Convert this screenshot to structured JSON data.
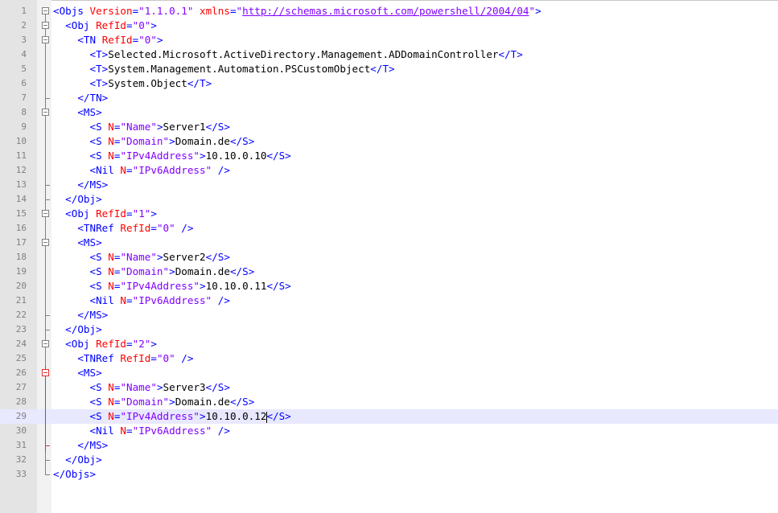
{
  "editor": {
    "caret": {
      "line": 29,
      "after_text": "10.10.0.12"
    },
    "colors": {
      "tag": "#0000ff",
      "attribute": "#ff0000",
      "value": "#8000ff",
      "text": "#000000",
      "line_numbers": "#808080",
      "current_line": "#e8e8ff",
      "gutter": "#e4e4e4"
    },
    "lines": [
      {
        "num": "1",
        "fold": "box-start",
        "indent": "",
        "tokens": [
          {
            "k": "tag",
            "t": "<Objs "
          },
          {
            "k": "attr",
            "t": "Version"
          },
          {
            "k": "tag",
            "t": "="
          },
          {
            "k": "val",
            "t": "\"1.1.0.1\""
          },
          {
            "k": "tag",
            "t": " "
          },
          {
            "k": "attr",
            "t": "xmlns"
          },
          {
            "k": "tag",
            "t": "="
          },
          {
            "k": "val",
            "t": "\""
          },
          {
            "k": "url",
            "t": "http://schemas.microsoft.com/powershell/2004/04"
          },
          {
            "k": "val",
            "t": "\""
          },
          {
            "k": "tag",
            "t": ">"
          }
        ]
      },
      {
        "num": "2",
        "fold": "box",
        "indent": "  ",
        "tokens": [
          {
            "k": "tag",
            "t": "<Obj "
          },
          {
            "k": "attr",
            "t": "RefId"
          },
          {
            "k": "tag",
            "t": "="
          },
          {
            "k": "val",
            "t": "\"0\""
          },
          {
            "k": "tag",
            "t": ">"
          }
        ]
      },
      {
        "num": "3",
        "fold": "box",
        "indent": "    ",
        "tokens": [
          {
            "k": "tag",
            "t": "<TN "
          },
          {
            "k": "attr",
            "t": "RefId"
          },
          {
            "k": "tag",
            "t": "="
          },
          {
            "k": "val",
            "t": "\"0\""
          },
          {
            "k": "tag",
            "t": ">"
          }
        ]
      },
      {
        "num": "4",
        "fold": "line",
        "indent": "      ",
        "tokens": [
          {
            "k": "tag",
            "t": "<T>"
          },
          {
            "k": "txt",
            "t": "Selected.Microsoft.ActiveDirectory.Management.ADDomainController"
          },
          {
            "k": "tag",
            "t": "</T>"
          }
        ]
      },
      {
        "num": "5",
        "fold": "line",
        "indent": "      ",
        "tokens": [
          {
            "k": "tag",
            "t": "<T>"
          },
          {
            "k": "txt",
            "t": "System.Management.Automation.PSCustomObject"
          },
          {
            "k": "tag",
            "t": "</T>"
          }
        ]
      },
      {
        "num": "6",
        "fold": "line",
        "indent": "      ",
        "tokens": [
          {
            "k": "tag",
            "t": "<T>"
          },
          {
            "k": "txt",
            "t": "System.Object"
          },
          {
            "k": "tag",
            "t": "</T>"
          }
        ]
      },
      {
        "num": "7",
        "fold": "end",
        "indent": "    ",
        "tokens": [
          {
            "k": "tag",
            "t": "</TN>"
          }
        ]
      },
      {
        "num": "8",
        "fold": "box",
        "indent": "    ",
        "tokens": [
          {
            "k": "tag",
            "t": "<MS>"
          }
        ]
      },
      {
        "num": "9",
        "fold": "line",
        "indent": "      ",
        "tokens": [
          {
            "k": "tag",
            "t": "<S "
          },
          {
            "k": "attr",
            "t": "N"
          },
          {
            "k": "tag",
            "t": "="
          },
          {
            "k": "val",
            "t": "\"Name\""
          },
          {
            "k": "tag",
            "t": ">"
          },
          {
            "k": "txt",
            "t": "Server1"
          },
          {
            "k": "tag",
            "t": "</S>"
          }
        ]
      },
      {
        "num": "10",
        "fold": "line",
        "indent": "      ",
        "tokens": [
          {
            "k": "tag",
            "t": "<S "
          },
          {
            "k": "attr",
            "t": "N"
          },
          {
            "k": "tag",
            "t": "="
          },
          {
            "k": "val",
            "t": "\"Domain\""
          },
          {
            "k": "tag",
            "t": ">"
          },
          {
            "k": "txt",
            "t": "Domain.de"
          },
          {
            "k": "tag",
            "t": "</S>"
          }
        ]
      },
      {
        "num": "11",
        "fold": "line",
        "indent": "      ",
        "tokens": [
          {
            "k": "tag",
            "t": "<S "
          },
          {
            "k": "attr",
            "t": "N"
          },
          {
            "k": "tag",
            "t": "="
          },
          {
            "k": "val",
            "t": "\"IPv4Address\""
          },
          {
            "k": "tag",
            "t": ">"
          },
          {
            "k": "txt",
            "t": "10.10.0.10"
          },
          {
            "k": "tag",
            "t": "</S>"
          }
        ]
      },
      {
        "num": "12",
        "fold": "line",
        "indent": "      ",
        "tokens": [
          {
            "k": "tag",
            "t": "<Nil "
          },
          {
            "k": "attr",
            "t": "N"
          },
          {
            "k": "tag",
            "t": "="
          },
          {
            "k": "val",
            "t": "\"IPv6Address\""
          },
          {
            "k": "tag",
            "t": " />"
          }
        ]
      },
      {
        "num": "13",
        "fold": "end",
        "indent": "    ",
        "tokens": [
          {
            "k": "tag",
            "t": "</MS>"
          }
        ]
      },
      {
        "num": "14",
        "fold": "end",
        "indent": "  ",
        "tokens": [
          {
            "k": "tag",
            "t": "</Obj>"
          }
        ]
      },
      {
        "num": "15",
        "fold": "box",
        "indent": "  ",
        "tokens": [
          {
            "k": "tag",
            "t": "<Obj "
          },
          {
            "k": "attr",
            "t": "RefId"
          },
          {
            "k": "tag",
            "t": "="
          },
          {
            "k": "val",
            "t": "\"1\""
          },
          {
            "k": "tag",
            "t": ">"
          }
        ]
      },
      {
        "num": "16",
        "fold": "line",
        "indent": "    ",
        "tokens": [
          {
            "k": "tag",
            "t": "<TNRef "
          },
          {
            "k": "attr",
            "t": "RefId"
          },
          {
            "k": "tag",
            "t": "="
          },
          {
            "k": "val",
            "t": "\"0\""
          },
          {
            "k": "tag",
            "t": " />"
          }
        ]
      },
      {
        "num": "17",
        "fold": "box",
        "indent": "    ",
        "tokens": [
          {
            "k": "tag",
            "t": "<MS>"
          }
        ]
      },
      {
        "num": "18",
        "fold": "line",
        "indent": "      ",
        "tokens": [
          {
            "k": "tag",
            "t": "<S "
          },
          {
            "k": "attr",
            "t": "N"
          },
          {
            "k": "tag",
            "t": "="
          },
          {
            "k": "val",
            "t": "\"Name\""
          },
          {
            "k": "tag",
            "t": ">"
          },
          {
            "k": "txt",
            "t": "Server2"
          },
          {
            "k": "tag",
            "t": "</S>"
          }
        ]
      },
      {
        "num": "19",
        "fold": "line",
        "indent": "      ",
        "tokens": [
          {
            "k": "tag",
            "t": "<S "
          },
          {
            "k": "attr",
            "t": "N"
          },
          {
            "k": "tag",
            "t": "="
          },
          {
            "k": "val",
            "t": "\"Domain\""
          },
          {
            "k": "tag",
            "t": ">"
          },
          {
            "k": "txt",
            "t": "Domain.de"
          },
          {
            "k": "tag",
            "t": "</S>"
          }
        ]
      },
      {
        "num": "20",
        "fold": "line",
        "indent": "      ",
        "tokens": [
          {
            "k": "tag",
            "t": "<S "
          },
          {
            "k": "attr",
            "t": "N"
          },
          {
            "k": "tag",
            "t": "="
          },
          {
            "k": "val",
            "t": "\"IPv4Address\""
          },
          {
            "k": "tag",
            "t": ">"
          },
          {
            "k": "txt",
            "t": "10.10.0.11"
          },
          {
            "k": "tag",
            "t": "</S>"
          }
        ]
      },
      {
        "num": "21",
        "fold": "line",
        "indent": "      ",
        "tokens": [
          {
            "k": "tag",
            "t": "<Nil "
          },
          {
            "k": "attr",
            "t": "N"
          },
          {
            "k": "tag",
            "t": "="
          },
          {
            "k": "val",
            "t": "\"IPv6Address\""
          },
          {
            "k": "tag",
            "t": " />"
          }
        ]
      },
      {
        "num": "22",
        "fold": "end",
        "indent": "    ",
        "tokens": [
          {
            "k": "tag",
            "t": "</MS>"
          }
        ]
      },
      {
        "num": "23",
        "fold": "end",
        "indent": "  ",
        "tokens": [
          {
            "k": "tag",
            "t": "</Obj>"
          }
        ]
      },
      {
        "num": "24",
        "fold": "box",
        "indent": "  ",
        "tokens": [
          {
            "k": "tag",
            "t": "<Obj "
          },
          {
            "k": "attr",
            "t": "RefId"
          },
          {
            "k": "tag",
            "t": "="
          },
          {
            "k": "val",
            "t": "\"2\""
          },
          {
            "k": "tag",
            "t": ">"
          }
        ]
      },
      {
        "num": "25",
        "fold": "line",
        "indent": "    ",
        "tokens": [
          {
            "k": "tag",
            "t": "<TNRef "
          },
          {
            "k": "attr",
            "t": "RefId"
          },
          {
            "k": "tag",
            "t": "="
          },
          {
            "k": "val",
            "t": "\"0\""
          },
          {
            "k": "tag",
            "t": " />"
          }
        ]
      },
      {
        "num": "26",
        "fold": "box-red",
        "indent": "    ",
        "tokens": [
          {
            "k": "tag",
            "t": "<MS>"
          }
        ]
      },
      {
        "num": "27",
        "fold": "line-red",
        "indent": "      ",
        "tokens": [
          {
            "k": "tag",
            "t": "<S "
          },
          {
            "k": "attr",
            "t": "N"
          },
          {
            "k": "tag",
            "t": "="
          },
          {
            "k": "val",
            "t": "\"Name\""
          },
          {
            "k": "tag",
            "t": ">"
          },
          {
            "k": "txt",
            "t": "Server3"
          },
          {
            "k": "tag",
            "t": "</S>"
          }
        ]
      },
      {
        "num": "28",
        "fold": "line-red",
        "indent": "      ",
        "tokens": [
          {
            "k": "tag",
            "t": "<S "
          },
          {
            "k": "attr",
            "t": "N"
          },
          {
            "k": "tag",
            "t": "="
          },
          {
            "k": "val",
            "t": "\"Domain\""
          },
          {
            "k": "tag",
            "t": ">"
          },
          {
            "k": "txt",
            "t": "Domain.de"
          },
          {
            "k": "tag",
            "t": "</S>"
          }
        ]
      },
      {
        "num": "29",
        "fold": "line-red",
        "indent": "      ",
        "current": true,
        "tokens": [
          {
            "k": "tag",
            "t": "<S "
          },
          {
            "k": "attr",
            "t": "N"
          },
          {
            "k": "tag",
            "t": "="
          },
          {
            "k": "val",
            "t": "\"IPv4Address\""
          },
          {
            "k": "tag",
            "t": ">"
          },
          {
            "k": "txt",
            "t": "10.10.0.12"
          },
          {
            "k": "caret",
            "t": ""
          },
          {
            "k": "tag",
            "t": "</S>"
          }
        ]
      },
      {
        "num": "30",
        "fold": "line-red",
        "indent": "      ",
        "tokens": [
          {
            "k": "tag",
            "t": "<Nil "
          },
          {
            "k": "attr",
            "t": "N"
          },
          {
            "k": "tag",
            "t": "="
          },
          {
            "k": "val",
            "t": "\"IPv6Address\""
          },
          {
            "k": "tag",
            "t": " />"
          }
        ]
      },
      {
        "num": "31",
        "fold": "end-red",
        "indent": "    ",
        "tokens": [
          {
            "k": "tag",
            "t": "</MS>"
          }
        ]
      },
      {
        "num": "32",
        "fold": "end",
        "indent": "  ",
        "tokens": [
          {
            "k": "tag",
            "t": "</Obj>"
          }
        ]
      },
      {
        "num": "33",
        "fold": "end-last",
        "indent": "",
        "tokens": [
          {
            "k": "tag",
            "t": "</Objs>"
          }
        ]
      }
    ]
  }
}
